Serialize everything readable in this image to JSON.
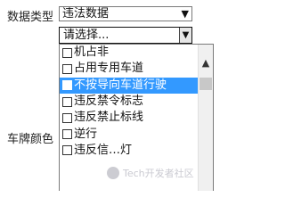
{
  "form": {
    "data_type_label": "数据类型",
    "data_type_value": "违法数据",
    "violation_select_value": "请选择...",
    "plate_color_label": "车牌颜色"
  },
  "dropdown": {
    "items": [
      {
        "label": "机占非",
        "checked": false,
        "highlighted": false
      },
      {
        "label": "占用专用车道",
        "checked": false,
        "highlighted": false
      },
      {
        "label": "不按导向车道行驶",
        "checked": false,
        "highlighted": true
      },
      {
        "label": "违反禁令标志",
        "checked": false,
        "highlighted": false
      },
      {
        "label": "违反禁止标线",
        "checked": false,
        "highlighted": false
      },
      {
        "label": "逆行",
        "checked": false,
        "highlighted": false
      },
      {
        "label": "违反信…灯",
        "checked": false,
        "highlighted": false
      }
    ]
  },
  "watermark": {
    "text": "Tech开发者社区"
  },
  "colors": {
    "highlight": "#3399ff"
  }
}
